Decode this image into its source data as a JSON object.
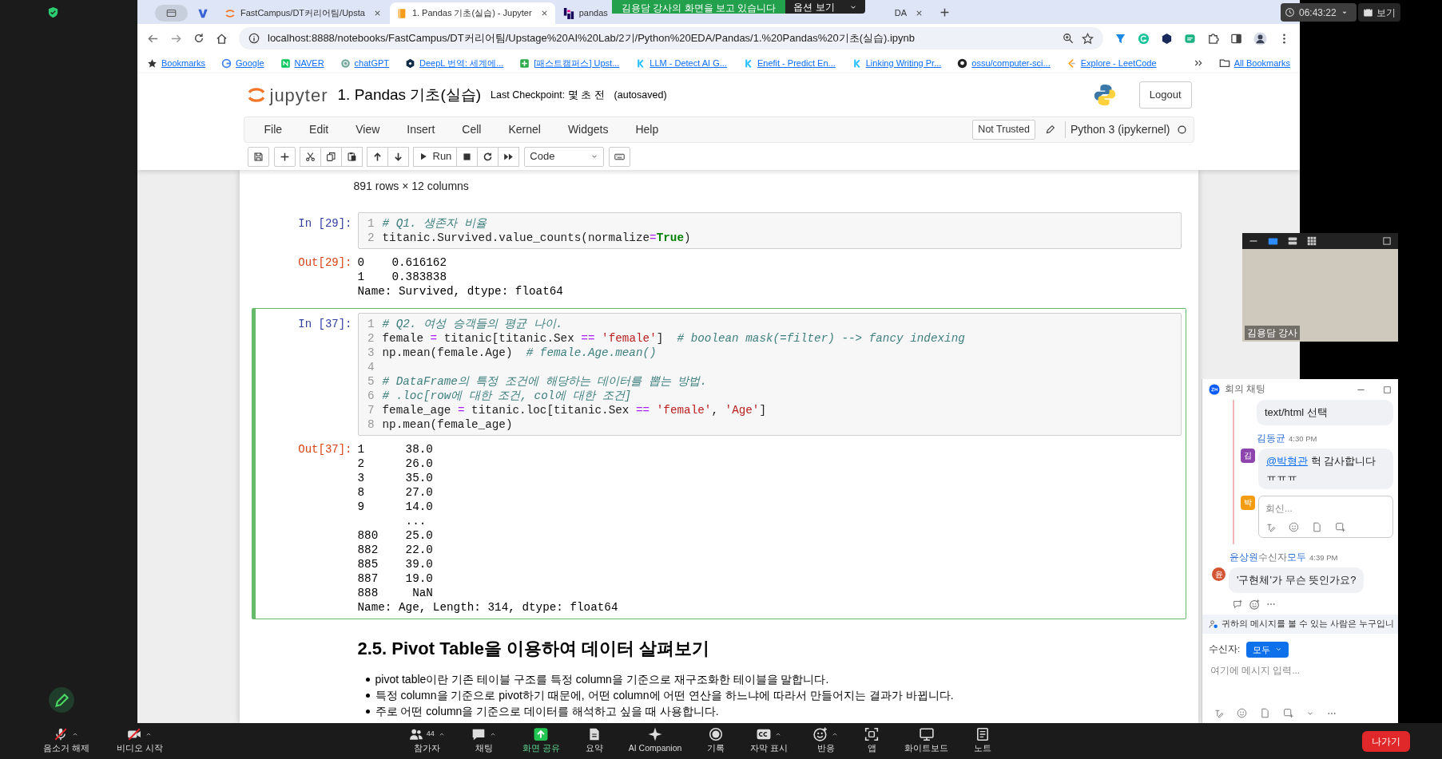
{
  "zoom": {
    "banner": "김용담 강사의 화면을 보고 있습니다",
    "options": "옵션 보기",
    "clock": "06:43:22",
    "view": "보기"
  },
  "browser": {
    "tabs": [
      {
        "kind": "group",
        "selected": false
      },
      {
        "kind": "pinned",
        "selected": false
      },
      {
        "kind": "jupyter",
        "label": "FastCampus/DT커리어팀/Upsta",
        "selected": false
      },
      {
        "kind": "notebook",
        "label": "1. Pandas 기초(실습) - Jupyter",
        "selected": true
      },
      {
        "kind": "pandas",
        "label": "pandas",
        "selected": false
      },
      {
        "kind": "plain",
        "label": "DA",
        "selected": false
      }
    ],
    "url": "localhost:8888/notebooks/FastCampus/DT커리어팀/Upstage%20AI%20Lab/2기/Python%20EDA/Pandas/1.%20Pandas%20기초(실습).ipynb",
    "bookmarks": [
      {
        "kind": "star",
        "label": "Bookmarks"
      },
      {
        "kind": "google",
        "label": "Google"
      },
      {
        "kind": "naver",
        "label": "NAVER"
      },
      {
        "kind": "chatgpt",
        "label": "chatGPT"
      },
      {
        "kind": "deepl",
        "label": "DeepL 번역: 세계에..."
      },
      {
        "kind": "fastcampus",
        "label": "[패스트캠퍼스] Upst..."
      },
      {
        "kind": "kaggle",
        "label": "LLM - Detect AI G..."
      },
      {
        "kind": "kaggle",
        "label": "Enefit - Predict En..."
      },
      {
        "kind": "kaggle",
        "label": "Linking Writing Pr..."
      },
      {
        "kind": "github",
        "label": "ossu/computer-sci..."
      },
      {
        "kind": "leetcode",
        "label": "Explore - LeetCode"
      }
    ],
    "all_bookmarks": "All Bookmarks"
  },
  "jupyter": {
    "logo": "jupyter",
    "title": "1. Pandas 기초(실습)",
    "checkpoint": "Last Checkpoint: 몇 초 전",
    "autosaved": "(autosaved)",
    "logout": "Logout",
    "menu": [
      "File",
      "Edit",
      "View",
      "Insert",
      "Cell",
      "Kernel",
      "Widgets",
      "Help"
    ],
    "trust": "Not Trusted",
    "kernel": "Python 3 (ipykernel)",
    "kernel_busy": false,
    "run": "Run",
    "cell_type": "Code"
  },
  "notebook": {
    "cells": [
      {
        "kind": "html_output",
        "text": "891 rows × 12 columns"
      },
      {
        "kind": "code",
        "selected": false,
        "prompt": "In [29]:",
        "lines": [
          {
            "no": "1",
            "code": "# Q1. 생존자 비율"
          },
          {
            "no": "2",
            "code": "titanic.Survived.value_counts(normalize=True)"
          }
        ],
        "out_prompt": "Out[29]:",
        "output": [
          "0    0.616162",
          "1    0.383838",
          "Name: Survived, dtype: float64"
        ]
      },
      {
        "kind": "code",
        "selected": true,
        "prompt": "In [37]:",
        "lines": [
          {
            "no": "1",
            "code": "# Q2. 여성 승객들의 평균 나이."
          },
          {
            "no": "2",
            "code": "female = titanic[titanic.Sex == 'female']  # boolean mask(=filter) --> fancy indexing"
          },
          {
            "no": "3",
            "code": "np.mean(female.Age)  # female.Age.mean()"
          },
          {
            "no": "4"
          },
          {
            "no": "5",
            "code": "# DataFrame의 특정 조건에 해당하는 데이터를 뽑는 방법."
          },
          {
            "no": "6",
            "code": "# .loc[row에 대한 조건, col에 대한 조건]"
          },
          {
            "no": "7",
            "code": "female_age = titanic.loc[titanic.Sex == 'female', 'Age']"
          },
          {
            "no": "8",
            "code": "np.mean(female_age)"
          }
        ],
        "out_prompt": "Out[37]:",
        "output": [
          "1      38.0",
          "2      26.0",
          "3      35.0",
          "8      27.0",
          "9      14.0",
          "       ...",
          "880    25.0",
          "882    22.0",
          "885    39.0",
          "887    19.0",
          "888     NaN",
          "Name: Age, Length: 314, dtype: float64"
        ]
      },
      {
        "kind": "markdown",
        "heading": "2.5. Pivot Table을 이용하여 데이터 살펴보기",
        "bullets": [
          "pivot table이란 기존 테이블 구조를 특정 column을 기준으로 재구조화한 테이블을 말합니다.",
          "특정 column을 기준으로 pivot하기 때문에, 어떤 column에 어떤 연산을 하느냐에 따라서 만들어지는 결과가 바뀝니다.",
          "주로 어떤 column을 기준으로 데이터를 해석하고 싶을 때 사용합니다."
        ]
      }
    ]
  },
  "video": {
    "caption": "김용담 강사"
  },
  "chat": {
    "title": "회의 채팅",
    "items": [
      {
        "kind": "partial",
        "text": "text/html 선택"
      },
      {
        "kind": "thread_message",
        "sender": "김동균",
        "time": "4:30 PM",
        "avatar": "김",
        "color": "#8e44ad",
        "mention": "@박형관",
        "text": "헉 감사합니다 ㅠㅠㅠ"
      },
      {
        "kind": "reply_box",
        "avatar": "박",
        "color": "#f39c12",
        "placeholder": "회신..."
      },
      {
        "kind": "message",
        "sender": "윤상원",
        "recipient_label": "수신자",
        "recipient": "모두",
        "time": "4:39 PM",
        "avatar": "윤",
        "color": "#d35432",
        "text": "'구현체'가 무슨 뜻인가요?"
      }
    ],
    "notice": "귀하의 메시지를 볼 수 있는 사람은 누구입니",
    "to_label": "수신자:",
    "to_value": "모두",
    "input_placeholder": "여기에 메시지 입력..."
  },
  "toolbar": {
    "left": [
      {
        "kind": "mic",
        "label": "음소거 해제",
        "off": true
      },
      {
        "kind": "video",
        "label": "비디오 시작",
        "off": true
      }
    ],
    "center": [
      {
        "kind": "participants",
        "label": "참가자",
        "count": "44",
        "caret": true,
        "active": false
      },
      {
        "kind": "chat",
        "label": "채팅",
        "caret": true,
        "active": false
      },
      {
        "kind": "share",
        "label": "화면 공유",
        "caret": false,
        "active": true
      },
      {
        "kind": "summary",
        "label": "요약",
        "caret": false,
        "active": false
      },
      {
        "kind": "ai",
        "label": "AI Companion",
        "caret": false,
        "active": false
      },
      {
        "kind": "record",
        "label": "기록",
        "caret": false,
        "active": false
      },
      {
        "kind": "captions",
        "label": "자막 표시",
        "caret": true,
        "active": false
      },
      {
        "kind": "reactions",
        "label": "반응",
        "caret": true,
        "active": false
      },
      {
        "kind": "apps",
        "label": "앱",
        "caret": false,
        "active": false
      },
      {
        "kind": "whiteboard",
        "label": "화이트보드",
        "caret": false,
        "active": false
      },
      {
        "kind": "notes",
        "label": "노트",
        "caret": false,
        "active": false
      }
    ],
    "leave": "나가기"
  }
}
